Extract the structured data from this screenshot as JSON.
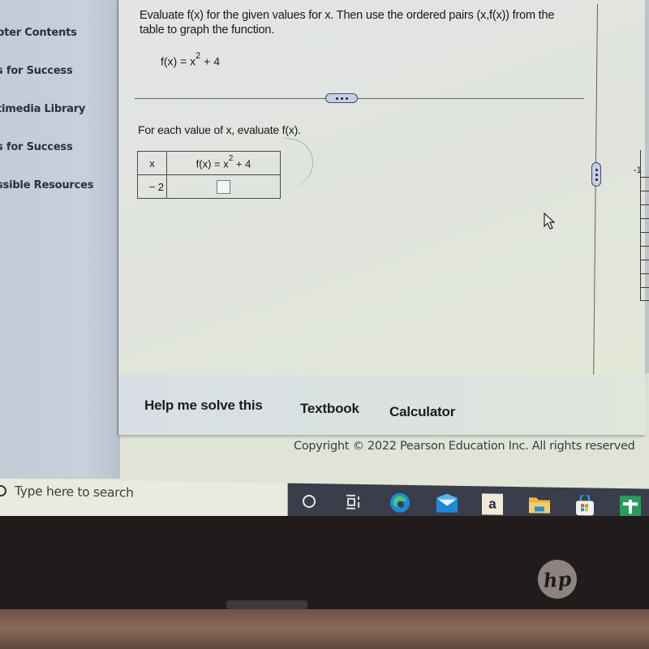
{
  "sidebar": {
    "items": [
      {
        "label": "pter Contents",
        "has_chevron": true
      },
      {
        "label": "s for Success",
        "has_chevron": false
      },
      {
        "label": "timedia Library",
        "has_chevron": false
      },
      {
        "label": "s for Success",
        "has_chevron": true
      },
      {
        "label": "ssible Resources",
        "has_chevron": false
      }
    ],
    "chevron_glyph": ">"
  },
  "question": {
    "prompt": "Evaluate f(x) for the given values for x.  Then use the ordered pairs (x,f(x)) from the table to graph the function.",
    "formula_base": "f(x) = x",
    "formula_exp": "2",
    "formula_tail": " + 4",
    "instruction": "For each value of x, evaluate f(x).",
    "table": {
      "headers": {
        "x": "x",
        "f_base": "f(x) = x",
        "f_exp": "2",
        "f_tail": " + 4"
      },
      "rows": [
        {
          "x": "− 2",
          "fx": ""
        }
      ]
    }
  },
  "graph": {
    "partial_tick_label": "-1"
  },
  "footer": {
    "help": "Help me solve this",
    "textbook": "Textbook",
    "calculator": "Calculator",
    "copyright": "Copyright © 2022 Pearson Education Inc. All rights reserved"
  },
  "taskbar": {
    "search_placeholder": "Type here to search",
    "icons": [
      "cortana-icon",
      "task-view-icon",
      "edge-icon",
      "mail-icon",
      "amazon-icon",
      "file-explorer-icon",
      "store-icon",
      "sheets-icon"
    ],
    "amazon_glyph": "a"
  },
  "device": {
    "brand": "hp"
  }
}
